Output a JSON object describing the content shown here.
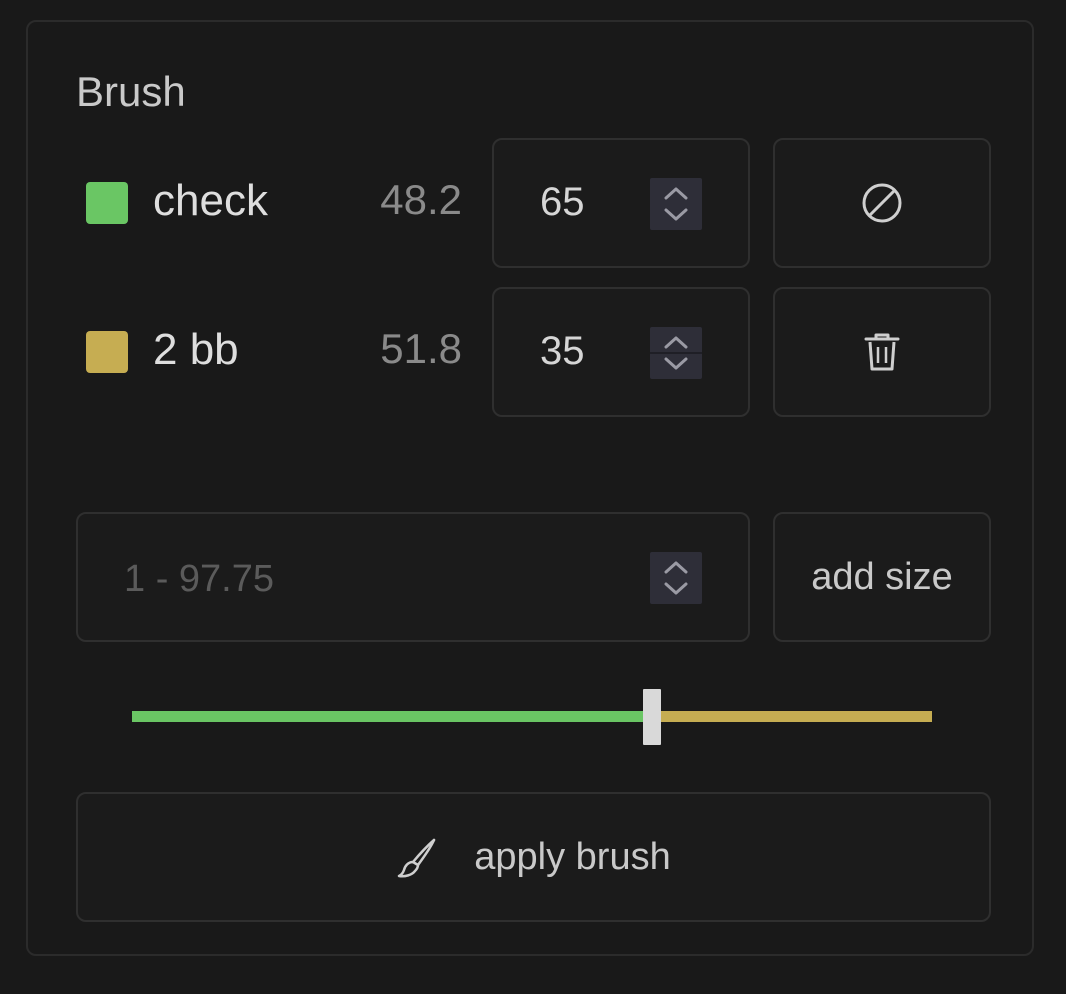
{
  "panel": {
    "title": "Brush"
  },
  "rows": [
    {
      "name": "check",
      "value": "48.2",
      "input_value": "65",
      "color": "#6ac664",
      "action_icon": "cancel-icon"
    },
    {
      "name": "2 bb",
      "value": "51.8",
      "input_value": "35",
      "color": "#c6ad52",
      "action_icon": "trash-icon"
    }
  ],
  "size_input": {
    "placeholder": "1 - 97.75"
  },
  "add_size": {
    "label": "add size"
  },
  "slider": {
    "split_fraction": 0.65,
    "left_color": "#6ac664",
    "right_color": "#c6ad52"
  },
  "apply": {
    "label": "apply brush",
    "icon": "brush-icon"
  }
}
